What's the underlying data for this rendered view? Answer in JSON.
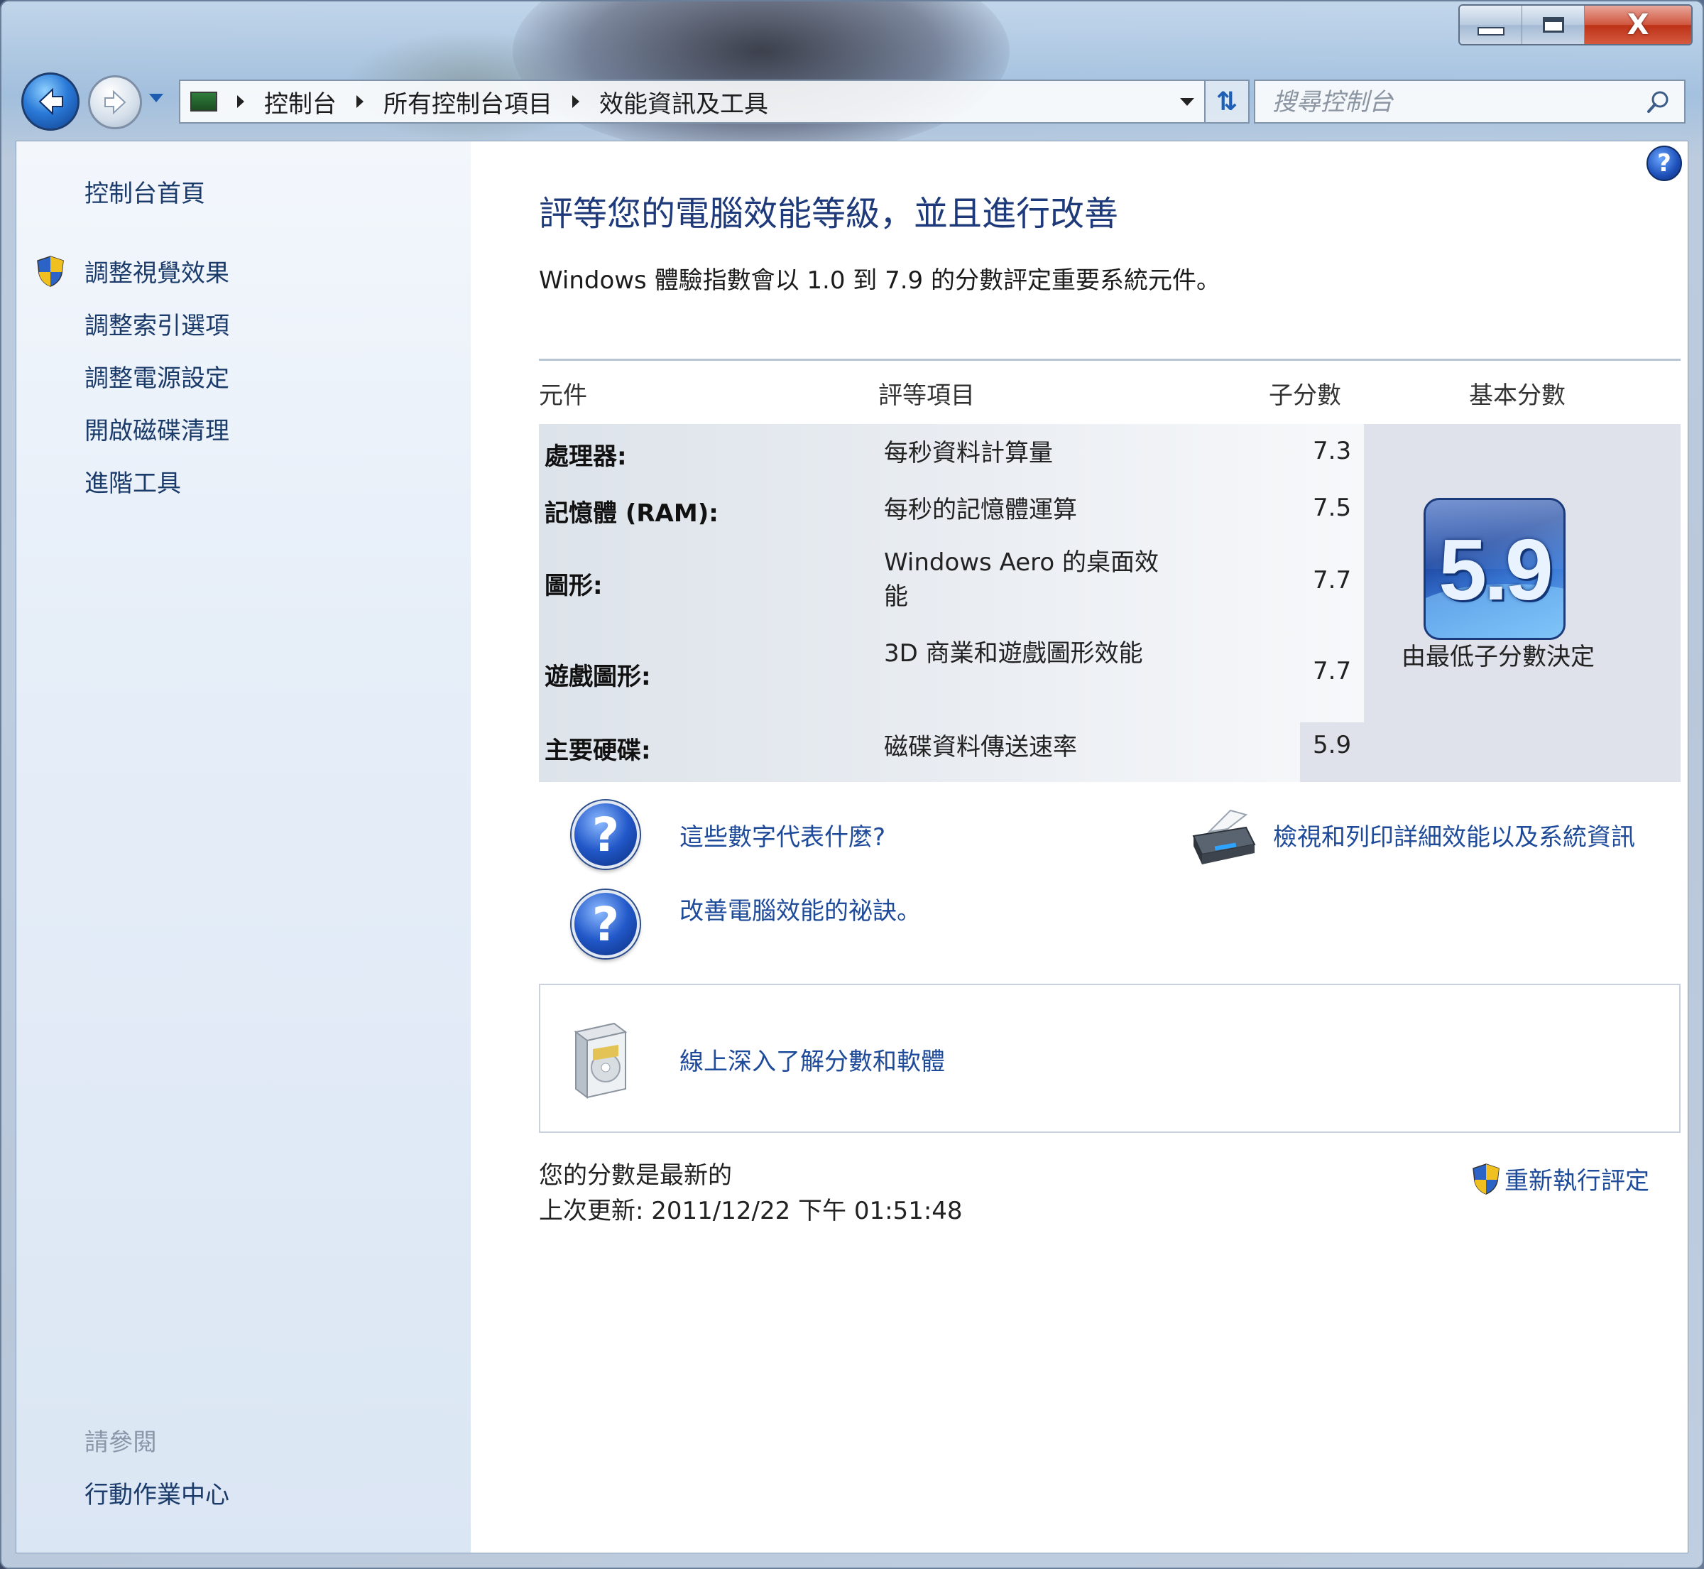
{
  "window": {
    "close_label": "X"
  },
  "address": {
    "crumbs": [
      "控制台",
      "所有控制台項目",
      "效能資訊及工具"
    ]
  },
  "search": {
    "placeholder": "搜尋控制台"
  },
  "sidebar": {
    "home": "控制台首頁",
    "items": [
      "調整視覺效果",
      "調整索引選項",
      "調整電源設定",
      "開啟磁碟清理",
      "進階工具"
    ],
    "see_also_label": "請參閱",
    "see_also_items": [
      "行動作業中心"
    ]
  },
  "main": {
    "title": "評等您的電腦效能等級，並且進行改善",
    "intro": "Windows 體驗指數會以 1.0 到 7.9 的分數評定重要系統元件。",
    "table": {
      "headers": {
        "component": "元件",
        "rated": "評等項目",
        "subscore": "子分數",
        "base": "基本分數"
      },
      "rows": [
        {
          "component": "處理器:",
          "rated": "每秒資料計算量",
          "subscore": "7.3"
        },
        {
          "component": "記憶體 (RAM):",
          "rated": "每秒的記憶體運算",
          "subscore": "7.5"
        },
        {
          "component": "圖形:",
          "rated": "Windows Aero 的桌面效能",
          "subscore": "7.7"
        },
        {
          "component": "遊戲圖形:",
          "rated": "3D 商業和遊戲圖形效能",
          "subscore": "7.7"
        },
        {
          "component": "主要硬碟:",
          "rated": "磁碟資料傳送速率",
          "subscore": "5.9"
        }
      ],
      "base_score": "5.9",
      "base_caption": "由最低子分數決定"
    },
    "links": {
      "what_numbers": "這些數字代表什麼?",
      "improve_tips": "改善電腦效能的祕訣。",
      "view_print": "檢視和列印詳細效能以及系統資訊",
      "learn_online": "線上深入了解分數和軟體"
    },
    "status": {
      "line1": "您的分數是最新的",
      "line2": "上次更新: 2011/12/22 下午 01:51:48"
    },
    "rerun": "重新執行評定",
    "help_glyph": "?"
  }
}
